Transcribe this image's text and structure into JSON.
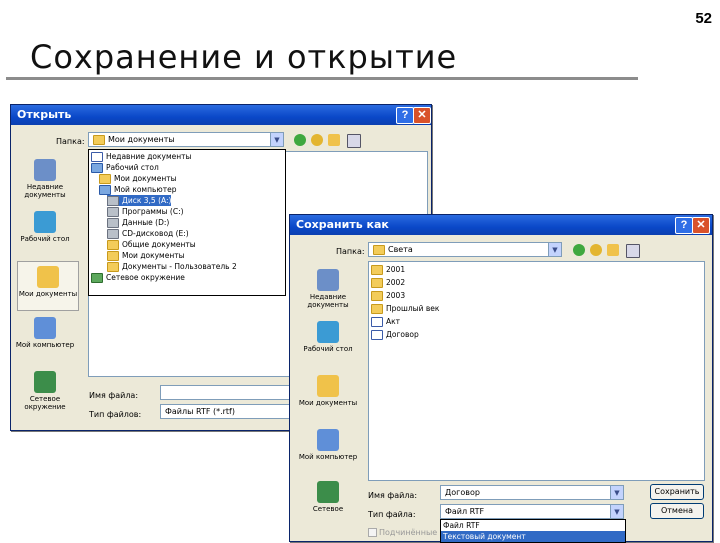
{
  "slide": {
    "number": "52",
    "title": "Сохранение и открытие"
  },
  "open_dialog": {
    "title": "Открыть",
    "folder_label": "Папка:",
    "folder_value": "Мои документы",
    "places": [
      "Недавние документы",
      "Рабочий стол",
      "Мои документы",
      "Мой компьютер",
      "Сетевое окружение"
    ],
    "dropdown_items": [
      "Недавние документы",
      "Рабочий стол",
      "Мои документы",
      "Мой компьютер",
      "Диск 3,5 (A:)",
      "Программы (C:)",
      "Данные (D:)",
      "CD-дисковод (E:)",
      "Общие документы",
      "Мои документы",
      "Документы - Пользователь 2",
      "Сетевое окружение"
    ],
    "dropdown_selected_index": 4,
    "filename_label": "Имя файла:",
    "filetype_label": "Тип файлов:",
    "filetype_value": "Файлы RTF (*.rtf)"
  },
  "save_dialog": {
    "title": "Сохранить как",
    "folder_label": "Папка:",
    "folder_value": "Света",
    "places": [
      "Недавние документы",
      "Рабочий стол",
      "Мои документы",
      "Мой компьютер",
      "Сетевое"
    ],
    "files": [
      {
        "name": "2001",
        "icon": "folder-icon"
      },
      {
        "name": "2002",
        "icon": "folder-icon"
      },
      {
        "name": "2003",
        "icon": "folder-icon"
      },
      {
        "name": "Прошлый век",
        "icon": "folder-icon"
      },
      {
        "name": "Акт",
        "icon": "document-icon"
      },
      {
        "name": "Договор",
        "icon": "document-icon"
      }
    ],
    "filename_label": "Имя файла:",
    "filename_value": "Договор",
    "filetype_label": "Тип файла:",
    "filetype_value": "Файл RTF",
    "filetype_options": [
      "Файл RTF",
      "Текстовый документ"
    ],
    "filetype_selected_index": 1,
    "save_button": "Сохранить",
    "cancel_button": "Отмена",
    "checkbox_label": "Подчинённые"
  }
}
